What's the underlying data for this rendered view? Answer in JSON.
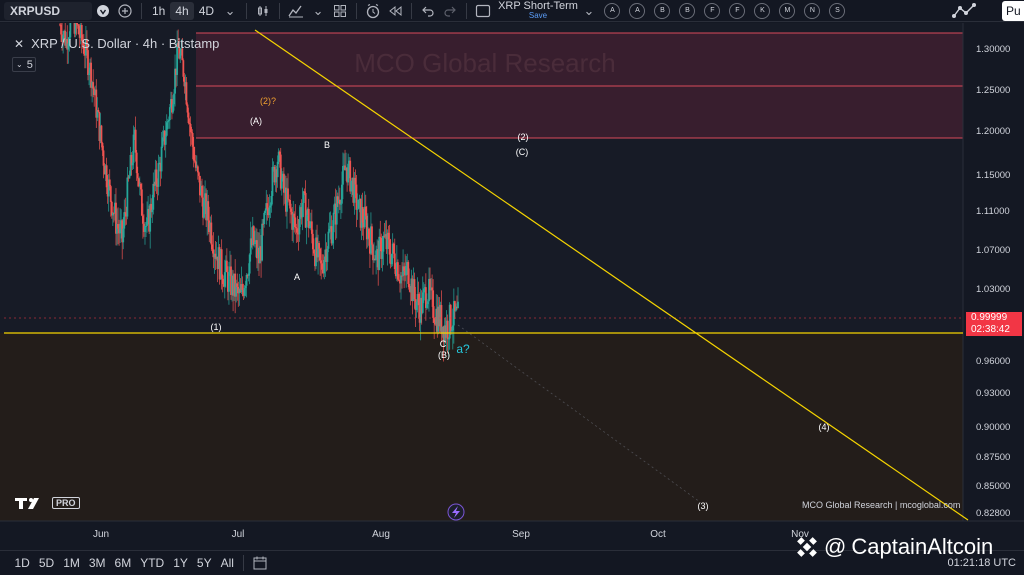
{
  "toolbar": {
    "symbol": "XRPUSD",
    "intervals": [
      "1h",
      "4h",
      "4D"
    ],
    "active_interval": "4h",
    "layout_name": "XRP Short-Term",
    "save_label": "Save",
    "alpha_buttons": [
      "A",
      "A",
      "B",
      "B",
      "F",
      "F",
      "K",
      "M",
      "N",
      "S"
    ],
    "publish_label": "Pu",
    "icons": [
      "heart-icon",
      "add-symbol-icon",
      "candles-icon",
      "indicators-icon",
      "templates-icon",
      "alert-icon",
      "replay-icon",
      "undo-icon",
      "redo-icon",
      "fullscreen-icon"
    ]
  },
  "legend": {
    "title": "XRP / U.S. Dollar · 4h · Bitstamp",
    "indicator_count": "5"
  },
  "chart_data": {
    "type": "candlestick",
    "symbol": "XRP / U.S. Dollar",
    "interval": "4h",
    "exchange": "Bitstamp",
    "watermark_text": "MCO Global Research",
    "y_axis_ticks": [
      1.3,
      1.25,
      1.2,
      1.15,
      1.11,
      1.07,
      1.03,
      0.999,
      0.96,
      0.93,
      0.9,
      0.875,
      0.85,
      0.828
    ],
    "y_axis_labels": [
      "1.30000",
      "1.25000",
      "1.20000",
      "1.15000",
      "1.11000",
      "1.07000",
      "1.03000",
      "0.99999",
      "0.96000",
      "0.93000",
      "0.90000",
      "0.87500",
      "0.85000",
      "0.82800"
    ],
    "x_axis_labels": [
      "Jun",
      "Jul",
      "Aug",
      "Sep",
      "Oct",
      "Nov"
    ],
    "current_price": "0.99999",
    "countdown": "02:38:42",
    "close_series": [
      1.33,
      1.31,
      1.34,
      1.32,
      1.3,
      1.27,
      1.22,
      1.17,
      1.13,
      1.1,
      1.08,
      1.14,
      1.19,
      1.12,
      1.09,
      1.13,
      1.16,
      1.2,
      1.24,
      1.3,
      1.27,
      1.2,
      1.15,
      1.12,
      1.1,
      1.07,
      1.05,
      1.04,
      1.03,
      1.02,
      1.05,
      1.08,
      1.06,
      1.1,
      1.14,
      1.17,
      1.13,
      1.11,
      1.09,
      1.12,
      1.1,
      1.07,
      1.05,
      1.08,
      1.1,
      1.13,
      1.16,
      1.14,
      1.11,
      1.1,
      1.08,
      1.06,
      1.08,
      1.07,
      1.06,
      1.04,
      1.05,
      1.02,
      1.01,
      1.03,
      1.01,
      1.0,
      0.99,
      1.0,
      1.0
    ],
    "resistance_zone": [
      1.186,
      1.32
    ],
    "horizontal_line": 0.984,
    "trendline": {
      "from": {
        "x": "May",
        "y": 1.33
      },
      "to": {
        "x": "Nov",
        "y": 0.82
      }
    },
    "wave_labels": [
      {
        "text": "(2)?",
        "color": "#f0a030"
      },
      {
        "text": "(A)",
        "color": "#ffffff"
      },
      {
        "text": "B",
        "color": "#ffffff"
      },
      {
        "text": "(2)",
        "color": "#ffffff"
      },
      {
        "text": "(C)",
        "color": "#ffffff"
      },
      {
        "text": "A",
        "color": "#ffffff"
      },
      {
        "text": "(1)",
        "color": "#ffffff"
      },
      {
        "text": "C",
        "color": "#ffffff"
      },
      {
        "text": "(B)",
        "color": "#ffffff"
      },
      {
        "text": "a?",
        "color": "#26c6da"
      },
      {
        "text": "(4)",
        "color": "#ffffff"
      },
      {
        "text": "(3)",
        "color": "#ffffff"
      }
    ],
    "colors": {
      "up": "#26a69a",
      "down": "#ef5350",
      "trendline": "#f5d400",
      "zone": "#d84a5a",
      "price_tag": "#f23645"
    }
  },
  "footer": {
    "tv_logo": "TV",
    "tv_pro": "PRO",
    "site_tag": "MCO Global Research | mcoglobal.com",
    "ranges": [
      "1D",
      "5D",
      "1M",
      "3M",
      "6M",
      "YTD",
      "1Y",
      "5Y",
      "All"
    ],
    "utc_time": "01:21:18 UTC",
    "watermark": "CaptainAltcoin"
  }
}
